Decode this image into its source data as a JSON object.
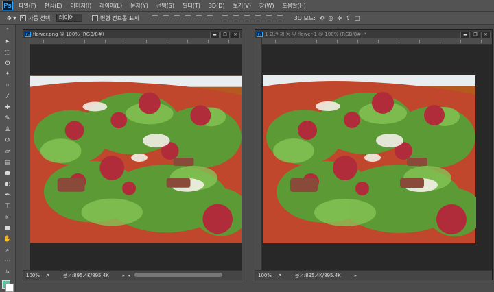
{
  "app": {
    "logo_text": "Ps"
  },
  "menu": [
    "파일(F)",
    "편집(E)",
    "이미지(I)",
    "레이어(L)",
    "문자(Y)",
    "선택(S)",
    "필터(T)",
    "3D(D)",
    "보기(V)",
    "창(W)",
    "도움말(H)"
  ],
  "options": {
    "auto_select_label": "자동 선택:",
    "auto_select_checked": true,
    "auto_select_value": "레이어",
    "transform_label": "변형 컨트롤 표시",
    "transform_checked": false,
    "mode_label": "3D 모드:"
  },
  "windows": [
    {
      "title": "flower.png @ 100% (RGB/8#)",
      "status_zoom": "100%",
      "status_doc": "문서:895.4K/895.4K",
      "active": true
    },
    {
      "title": "1 교관 제 동 및 flower-1 @ 100% (RGB/8#) *",
      "status_zoom": "100%",
      "status_doc": "문서:895.4K/895.4K",
      "active": false
    }
  ],
  "colors": {
    "foreground": "#5fbf9f",
    "background": "#ffffff",
    "accent": "#31a8ff"
  }
}
